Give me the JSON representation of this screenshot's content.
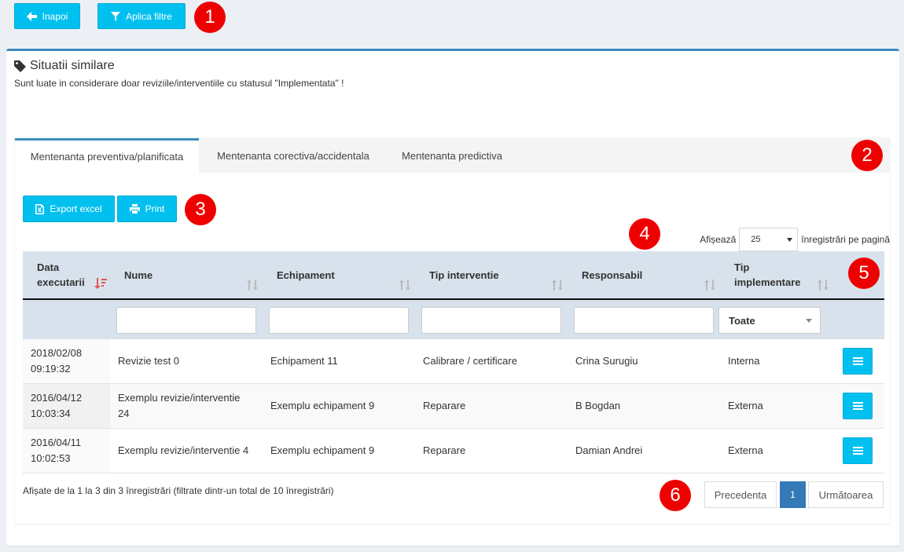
{
  "toolbar": {
    "back_label": "Inapoi",
    "filter_label": "Aplica filtre",
    "back_icon": "arrow-left-icon",
    "filter_icon": "filter-icon"
  },
  "markers": [
    "1",
    "2",
    "3",
    "4",
    "5",
    "6"
  ],
  "box": {
    "title": "Situatii similare",
    "title_icon": "tag-icon",
    "subtitle": "Sunt luate in considerare doar reviziile/interventiile cu statusul \"Implementata\" !"
  },
  "tabs": [
    {
      "label": "Mentenanta preventiva/planificata",
      "active": true
    },
    {
      "label": "Mentenanta corectiva/accidentala",
      "active": false
    },
    {
      "label": "Mentenanta predictiva",
      "active": false
    }
  ],
  "actions": {
    "export_label": "Export excel",
    "print_label": "Print"
  },
  "length": {
    "prefix": "Afișează",
    "value": "25",
    "suffix": "înregistrări pe pagină"
  },
  "table": {
    "columns": [
      {
        "line1": "Data",
        "line2": "executarii"
      },
      {
        "line1": "Nume",
        "line2": ""
      },
      {
        "line1": "Echipament",
        "line2": ""
      },
      {
        "line1": "Tip interventie",
        "line2": ""
      },
      {
        "line1": "Responsabil",
        "line2": ""
      },
      {
        "line1": "Tip",
        "line2": "implementare"
      }
    ],
    "filter_select_value": "Toate",
    "rows": [
      {
        "date": "2018/02/08",
        "time": "09:19:32",
        "name1": "Revizie test 0",
        "name2": "",
        "equipment": "Echipament 11",
        "type": "Calibrare / certificare",
        "responsible": "Crina Surugiu",
        "impl": "Interna"
      },
      {
        "date": "2016/04/12",
        "time": "10:03:34",
        "name1": "Exemplu revizie/interventie",
        "name2": "24",
        "equipment": "Exemplu echipament 9",
        "type": "Reparare",
        "responsible": "B Bogdan",
        "impl": "Externa"
      },
      {
        "date": "2016/04/11",
        "time": "10:02:53",
        "name1": "Exemplu revizie/interventie 4",
        "name2": "",
        "equipment": "Exemplu echipament 9",
        "type": "Reparare",
        "responsible": "Damian Andrei",
        "impl": "Externa"
      }
    ]
  },
  "footer": {
    "info": "Afișate de la 1 la 3 din 3 înregistrări (filtrate dintr-un total de 10 înregistrări)",
    "prev": "Precedenta",
    "page": "1",
    "next": "Următoarea"
  },
  "colors": {
    "accent": "#00c0ef",
    "primary": "#3c8dbc",
    "marker": "#ee0000",
    "header_bg": "#d7e2ec",
    "sort_active": "#e55353"
  }
}
